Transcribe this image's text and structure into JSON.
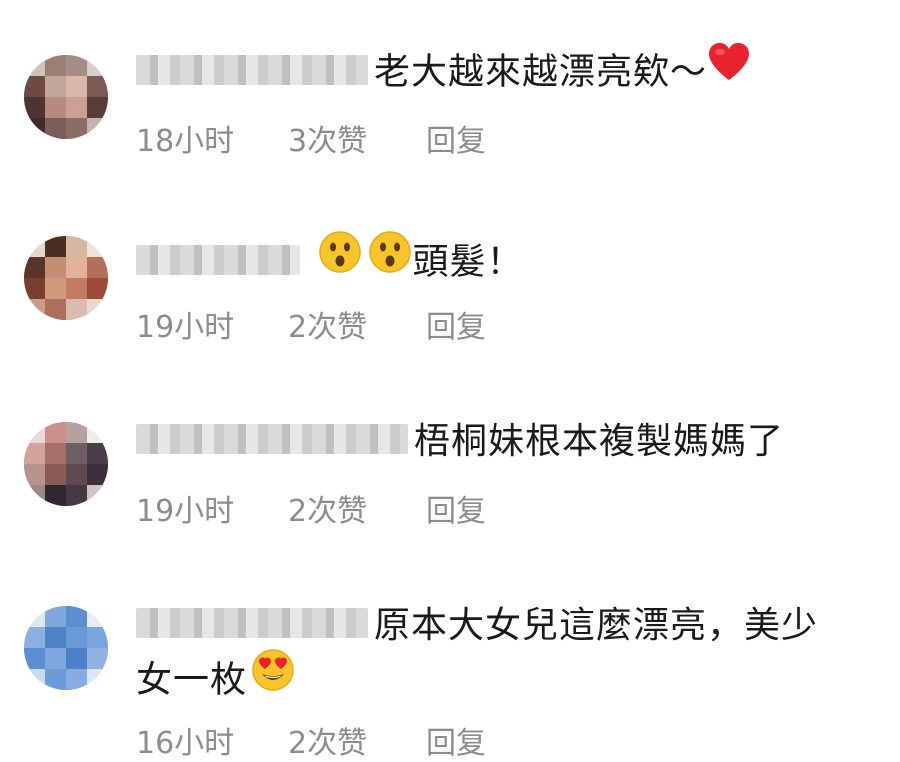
{
  "comments": [
    {
      "text": "老大越來越漂亮欸～",
      "emoji": "red-heart",
      "time": "18小时",
      "likes": "3次赞",
      "reply": "回复"
    },
    {
      "text": "頭髮！",
      "emoji": "surprised-face",
      "time": "19小时",
      "likes": "2次赞",
      "reply": "回复"
    },
    {
      "text": "梧桐妹根本複製媽媽了",
      "time": "19小时",
      "likes": "2次赞",
      "reply": "回复"
    },
    {
      "text_line1": "原本大女兒這麼漂亮，美少",
      "text_line2": "女一枚",
      "emoji": "heart-eyes-face",
      "time": "16小时",
      "likes": "2次赞",
      "reply": "回复"
    }
  ],
  "colors": {
    "meta_text": "#8c8c8c",
    "heart": "#e8232e",
    "emoji_face": "#f7c52a"
  }
}
